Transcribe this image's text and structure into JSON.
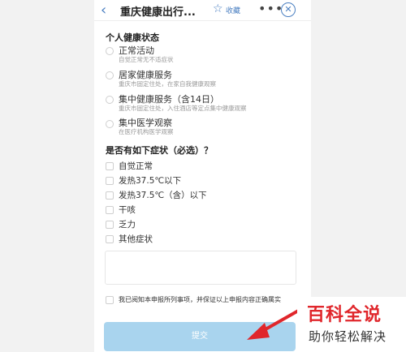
{
  "header": {
    "back_icon": "chevron-left-icon",
    "title": "重庆健康出行...",
    "favorite_label": "收藏",
    "more_icon": "ellipsis-icon",
    "close_icon": "close-circle-icon"
  },
  "health_status": {
    "title": "个人健康状态",
    "options": [
      {
        "label": "正常活动",
        "desc": "自觉正常无不适症状"
      },
      {
        "label": "居家健康服务",
        "desc": "重庆市固定住处，在家自我健康观察"
      },
      {
        "label": "集中健康服务（含14日）",
        "desc": "重庆市固定住处，入住酒店等定点集中健康观察"
      },
      {
        "label": "集中医学观察",
        "desc": "在医疗机构医学观察"
      }
    ]
  },
  "symptoms": {
    "title": "是否有如下症状（必选）？",
    "options": [
      "自觉正常",
      "发热37.5℃以下",
      "发热37.5℃（含）以下",
      "干咳",
      "乏力",
      "其他症状"
    ]
  },
  "agreement": {
    "text": "我已阅知本申报所列事项，并保证以上申报内容正确属实"
  },
  "submit": {
    "label": "提交"
  },
  "watermark": {
    "title": "百科全说",
    "subtitle": "助你轻松解决"
  },
  "colors": {
    "accent": "#4a7fc1",
    "submit_bg": "#a9d4ee",
    "arrow": "#e0262b"
  }
}
